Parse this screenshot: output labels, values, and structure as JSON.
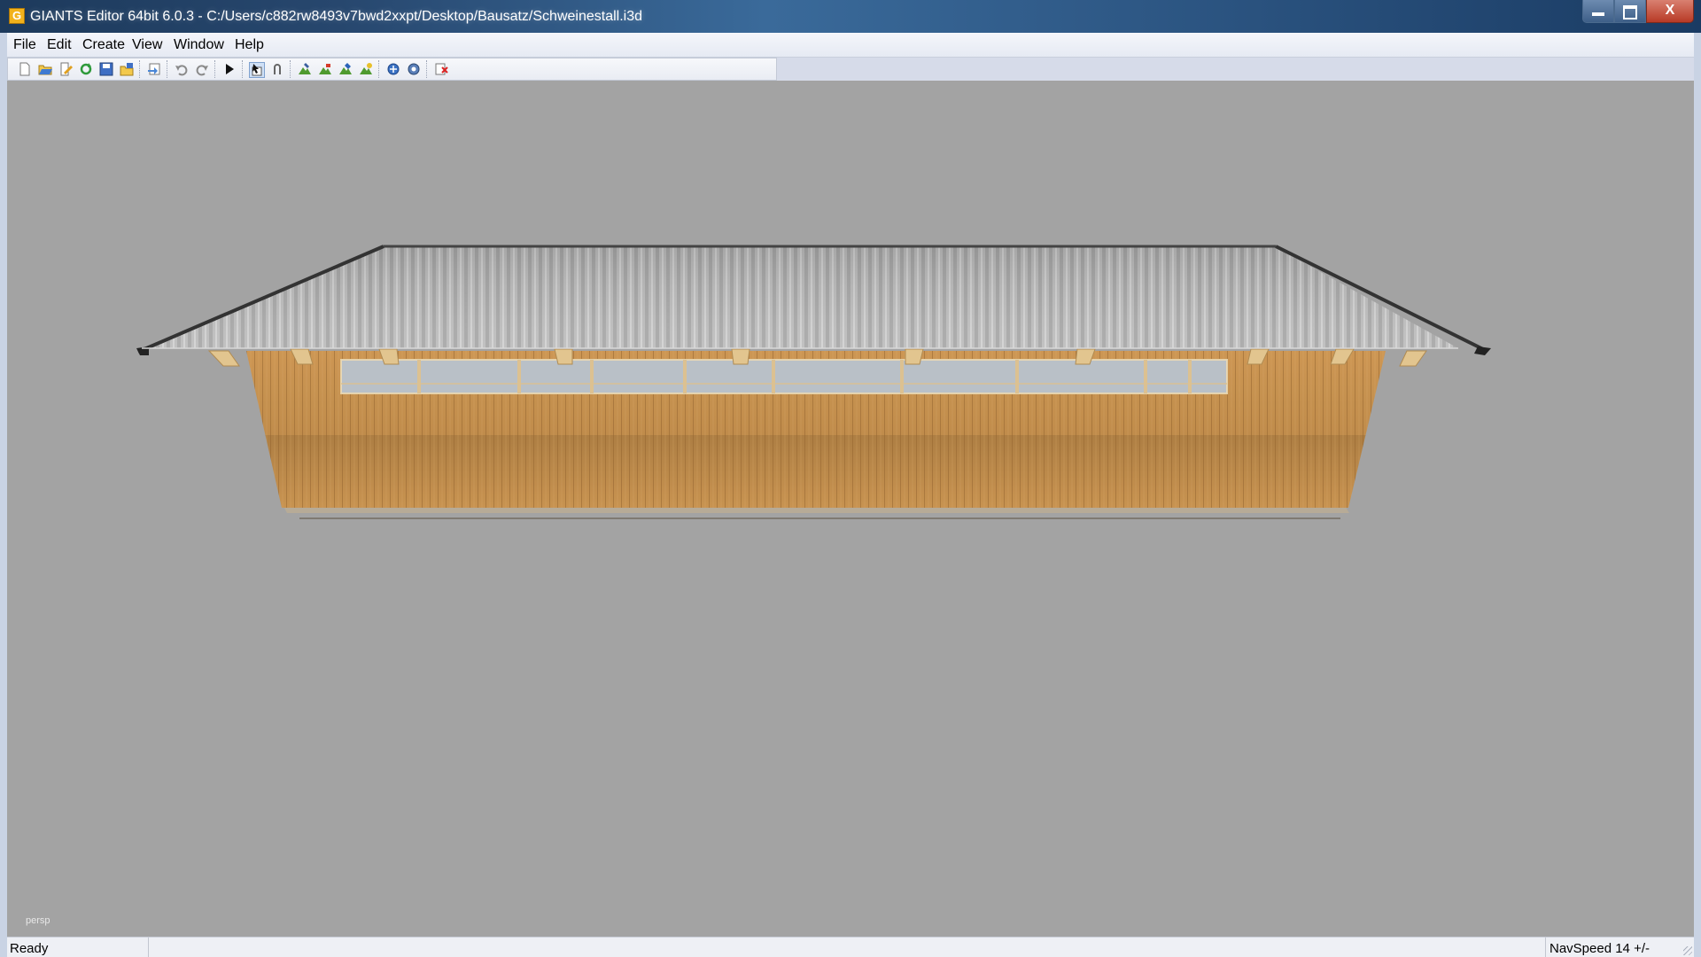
{
  "window": {
    "title": "GIANTS Editor 64bit 6.0.3 - C:/Users/c882rw8493v7bwd2xxpt/Desktop/Bausatz/Schweinestall.i3d",
    "app_icon_glyph": "G",
    "close_glyph": "X"
  },
  "menu": {
    "items": [
      {
        "label": "File"
      },
      {
        "label": "Edit"
      },
      {
        "label": "Create"
      },
      {
        "label": "View"
      },
      {
        "label": "Window"
      },
      {
        "label": "Help"
      }
    ]
  },
  "toolbar": {
    "icons": [
      "new-file-icon",
      "open-file-icon",
      "edit-file-icon",
      "reload-icon",
      "save-icon",
      "save-as-icon",
      "import-icon",
      "undo-icon",
      "redo-icon",
      "play-icon",
      "select-mode-icon",
      "move-mode-icon",
      "terrain-sculpt-icon",
      "terrain-paint-icon",
      "foliage-paint-icon",
      "grass-paint-icon",
      "refresh-scene-icon",
      "refresh-settings-icon",
      "remove-icon"
    ]
  },
  "viewport": {
    "camera_label": "persp",
    "background_color": "#a3a3a3"
  },
  "status": {
    "text": "Ready",
    "navspeed": "NavSpeed 14 +/-"
  }
}
